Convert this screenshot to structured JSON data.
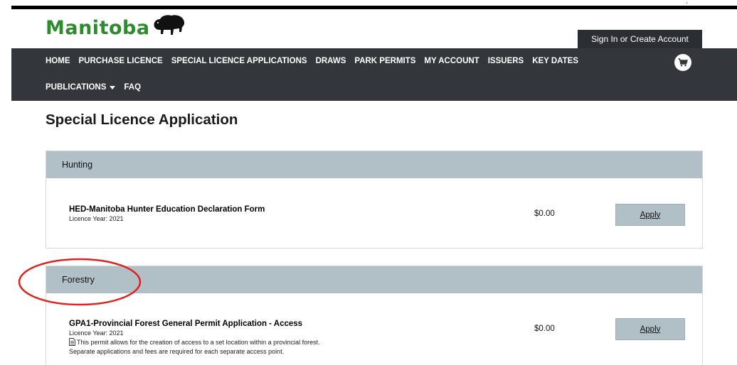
{
  "header": {
    "logo_text": "Manitoba",
    "signin_label": "Sign In or Create Account",
    "top_mark": "’"
  },
  "nav": {
    "row1": [
      "HOME",
      "PURCHASE LICENCE",
      "SPECIAL LICENCE APPLICATIONS",
      "DRAWS",
      "PARK PERMITS",
      "MY ACCOUNT",
      "ISSUERS",
      "KEY DATES"
    ],
    "row2": [
      "PUBLICATIONS",
      "FAQ"
    ],
    "cart_icon": "shopping-cart-icon"
  },
  "page": {
    "title": "Special Licence Application"
  },
  "sections": [
    {
      "header": "Hunting",
      "items": [
        {
          "title": "HED-Manitoba Hunter Education Declaration Form",
          "licence_year": "Licence Year: 2021",
          "price": "$0.00",
          "apply_label": "Apply"
        }
      ]
    },
    {
      "header": "Forestry",
      "items": [
        {
          "title": "GPA1-Provincial Forest General Permit Application - Access",
          "licence_year": "Licence Year: 2021",
          "description_line1": "This permit allows for the creation of access to a set location within a provincial forest.",
          "description_line2": "Separate applications and fees are required for each separate access point.",
          "price": "$0.00",
          "apply_label": "Apply"
        }
      ]
    }
  ],
  "colors": {
    "brand_green": "#2e8b2e",
    "nav_bg": "#33373b",
    "section_header_bg": "#b1c0c7",
    "annotation_red": "#e0201c"
  }
}
